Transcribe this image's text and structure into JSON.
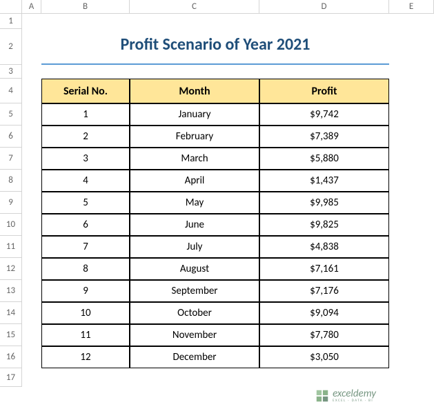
{
  "columns": [
    "A",
    "B",
    "C",
    "D",
    "E"
  ],
  "rows": [
    "1",
    "2",
    "3",
    "4",
    "5",
    "6",
    "7",
    "8",
    "9",
    "10",
    "11",
    "12",
    "13",
    "14",
    "15",
    "16",
    "17"
  ],
  "title": "Profit Scenario of Year 2021",
  "headers": {
    "serial": "Serial No.",
    "month": "Month",
    "profit": "Profit"
  },
  "data": [
    {
      "serial": "1",
      "month": "January",
      "profit": "$9,742"
    },
    {
      "serial": "2",
      "month": "February",
      "profit": "$7,389"
    },
    {
      "serial": "3",
      "month": "March",
      "profit": "$5,880"
    },
    {
      "serial": "4",
      "month": "April",
      "profit": "$1,437"
    },
    {
      "serial": "5",
      "month": "May",
      "profit": "$9,985"
    },
    {
      "serial": "6",
      "month": "June",
      "profit": "$9,825"
    },
    {
      "serial": "7",
      "month": "July",
      "profit": "$4,838"
    },
    {
      "serial": "8",
      "month": "August",
      "profit": "$7,161"
    },
    {
      "serial": "9",
      "month": "September",
      "profit": "$7,176"
    },
    {
      "serial": "10",
      "month": "October",
      "profit": "$9,094"
    },
    {
      "serial": "11",
      "month": "November",
      "profit": "$7,780"
    },
    {
      "serial": "12",
      "month": "December",
      "profit": "$3,050"
    }
  ],
  "watermark": {
    "main": "exceldemy",
    "sub": "EXCEL · DATA · BI"
  }
}
